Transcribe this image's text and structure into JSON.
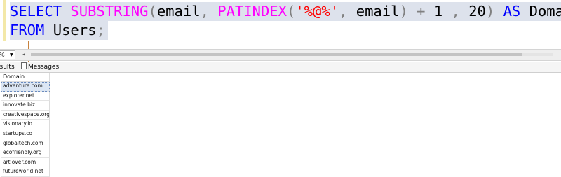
{
  "editor": {
    "line1": {
      "select_kw": "SELECT",
      "substring_fn": "SUBSTRING",
      "open1": "(",
      "email1": "email",
      "comma1": ",",
      "patindex_fn": "PATINDEX",
      "open2": "(",
      "pattern": "'%@%'",
      "comma2": ",",
      "email2": "email",
      "close2": ")",
      "plus": "+",
      "one": "1",
      "comma3": ",",
      "twenty": "20",
      "close1": ")",
      "as_kw": "AS",
      "alias": "Domain"
    },
    "line2": {
      "from_kw": "FROM",
      "table": "Users",
      "semicolon": ";"
    }
  },
  "zoom": {
    "value": "%"
  },
  "tabs": {
    "results": "esults",
    "messages": "Messages"
  },
  "grid": {
    "column": "Domain",
    "rows": [
      "adventure.com",
      "explorer.net",
      "innovate.biz",
      "creativespace.org",
      "visionary.io",
      "startups.co",
      "globaltech.com",
      "ecofriendly.org",
      "artlover.com",
      "futureworld.net"
    ]
  },
  "colors": {
    "keyword": "#0000ff",
    "function": "#ff00ff",
    "string": "#ff0000",
    "operator": "#808080",
    "annotation_arrow": "#c8833f",
    "selection": "#dde2ec"
  }
}
